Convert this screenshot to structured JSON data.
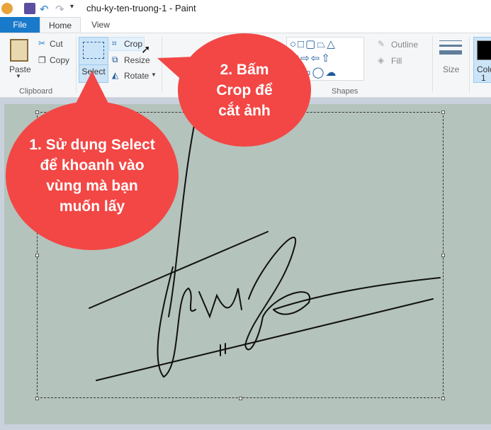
{
  "window": {
    "title": "chu-ky-ten-truong-1 - Paint"
  },
  "tabs": [
    {
      "label": "File"
    },
    {
      "label": "Home"
    },
    {
      "label": "View"
    }
  ],
  "clipboard": {
    "paste": "Paste",
    "cut": "Cut",
    "copy": "Copy",
    "group": "Clipboard"
  },
  "image": {
    "select": "Select",
    "crop": "Crop",
    "resize": "Resize",
    "rotate": "Rotate"
  },
  "shapes": {
    "outline": "Outline",
    "fill": "Fill",
    "group": "Shapes"
  },
  "size": {
    "label": "Size"
  },
  "color": {
    "label": "Colo",
    "num": "1"
  },
  "callouts": {
    "one": "1. Sử dụng Select để khoanh vào vùng mà bạn muốn lấy",
    "two": "2. Bấm Crop để cắt ảnh"
  },
  "colors": {
    "accent": "#1979ca",
    "callout": "#f24745",
    "canvas": "#b4c3bc"
  }
}
